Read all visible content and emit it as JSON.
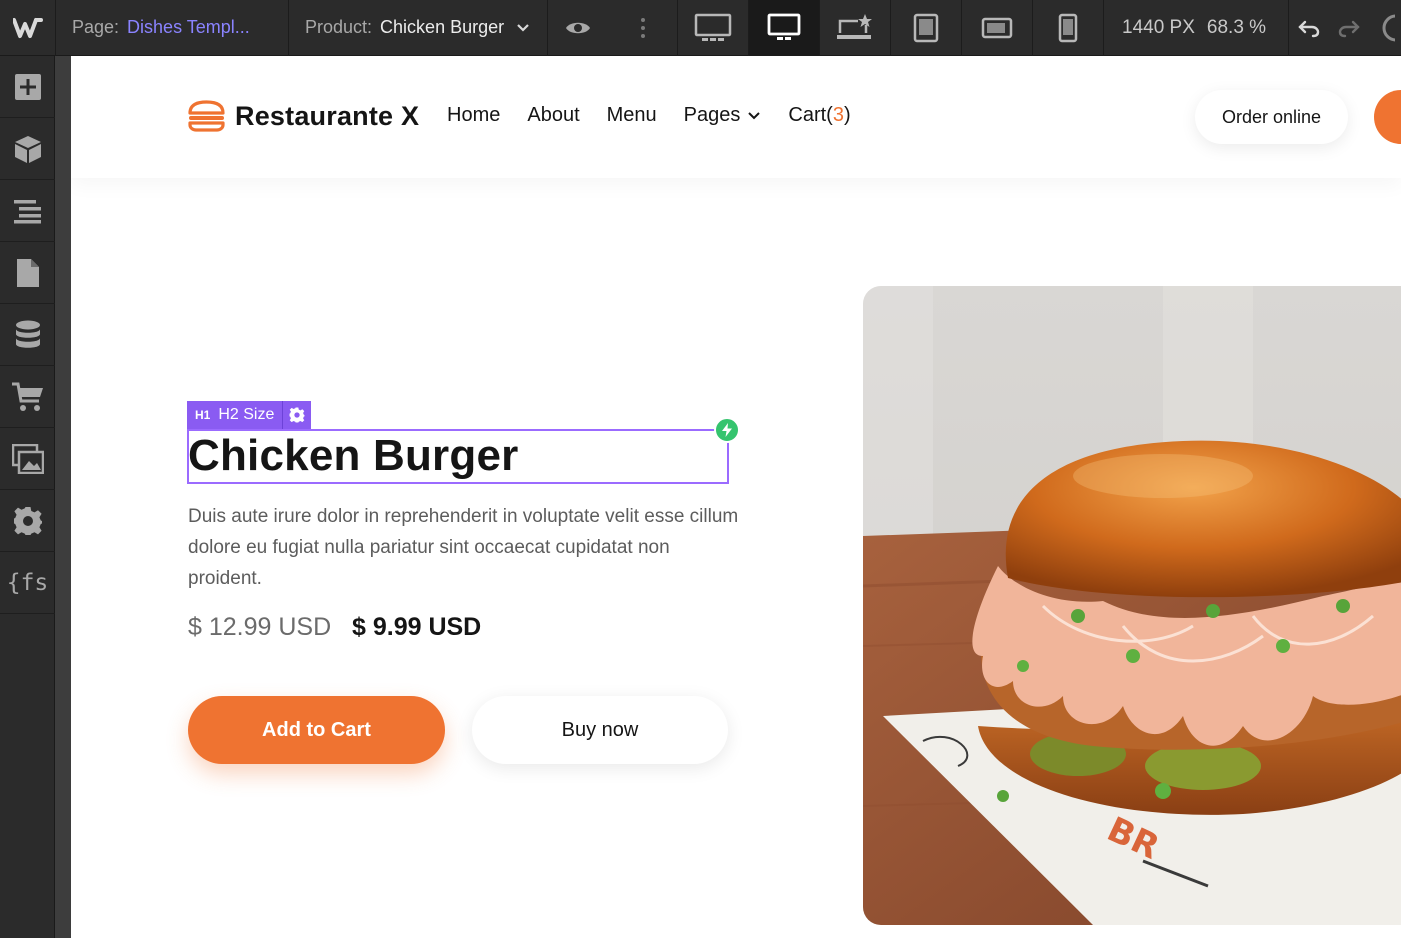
{
  "toolbar": {
    "page_label": "Page:",
    "page_value": "Dishes Templ...",
    "product_label": "Product:",
    "product_value": "Chicken Burger",
    "width_value": "1440 PX",
    "zoom_value": "68.3 %",
    "breakpoints": [
      "desktop-large-icon",
      "desktop-icon",
      "laptop-star-icon",
      "tablet-icon",
      "tablet-landscape-icon",
      "phone-icon"
    ],
    "active_breakpoint": "desktop-icon"
  },
  "sidebar": {
    "items": [
      "add-icon",
      "cube-icon",
      "navigator-icon",
      "pages-icon",
      "cms-icon",
      "ecommerce-icon",
      "assets-icon",
      "settings-icon",
      "finsweet-icon"
    ],
    "finsweet_text": "{fs"
  },
  "site": {
    "brand": "Restaurante X",
    "nav": {
      "home": "Home",
      "about": "About",
      "menu": "Menu",
      "pages": "Pages",
      "cart": "Cart",
      "cart_open": "(",
      "cart_count": "3",
      "cart_close": ")"
    },
    "order_online": "Order online"
  },
  "selection": {
    "tag_type": "H1",
    "tag_class": "H2 Size"
  },
  "product": {
    "title": "Chicken Burger",
    "description": "Duis aute irure dolor in reprehenderit in voluptate velit esse cillum dolore eu fugiat nulla pariatur sint occaecat cupidatat non proident.",
    "price_old": "$ 12.99 USD",
    "price_new": "$ 9.99 USD",
    "add_to_cart": "Add to Cart",
    "buy_now": "Buy now"
  },
  "colors": {
    "accent": "#ef7331",
    "selection": "#8a5bf2",
    "page_link": "#8a83ff",
    "toolbar_bg": "#2b2b2b"
  }
}
